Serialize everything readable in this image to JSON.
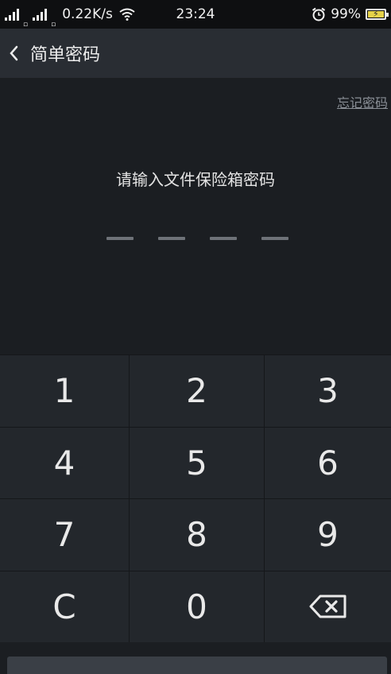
{
  "status_bar": {
    "network_speed": "0.22K/s",
    "time": "23:24",
    "battery_percent": "99%",
    "icons": [
      "signal-icon",
      "signal-icon",
      "wifi-icon",
      "alarm-icon",
      "battery-icon"
    ]
  },
  "header": {
    "back_icon": "back-arrow-icon",
    "title": "简单密码"
  },
  "main": {
    "forgot_link": "忘记密码",
    "prompt": "请输入文件保险箱密码",
    "pin_length": 4
  },
  "keypad": {
    "keys": [
      "1",
      "2",
      "3",
      "4",
      "5",
      "6",
      "7",
      "8",
      "9",
      "C",
      "0"
    ],
    "backspace_icon": "backspace-icon"
  }
}
